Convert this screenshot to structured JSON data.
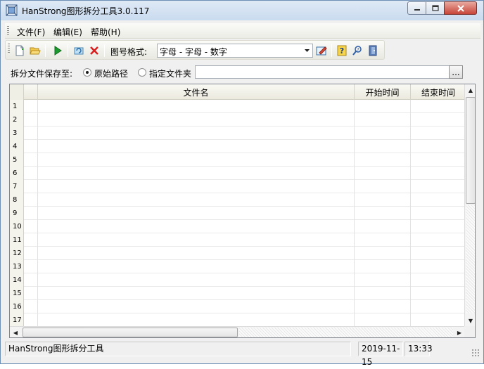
{
  "window": {
    "title": "HanStrong图形拆分工具3.0.117"
  },
  "menu": {
    "items": [
      "文件(F)",
      "编辑(E)",
      "帮助(H)"
    ]
  },
  "toolbar": {
    "buttons": [
      "new-file-icon",
      "open-folder-icon",
      "run-icon",
      "refresh-icon",
      "delete-icon",
      "edit-format-icon",
      "help-icon",
      "about-icon",
      "exit-icon"
    ],
    "format_label": "图号格式:",
    "format_value": "字母 - 字母 - 数字"
  },
  "save": {
    "label": "拆分文件保存至:",
    "option_original": "原始路径",
    "option_custom": "指定文件夹",
    "selected": "original",
    "path_value": "",
    "browse_label": "..."
  },
  "grid": {
    "columns": [
      "",
      "文件名",
      "开始时间",
      "结束时间"
    ],
    "row_numbers": [
      "1",
      "2",
      "3",
      "4",
      "5",
      "6",
      "7",
      "8",
      "9",
      "10",
      "11",
      "12",
      "13",
      "14",
      "15",
      "16",
      "17"
    ]
  },
  "status": {
    "app_name": "HanStrong图形拆分工具",
    "date": "2019-11-15",
    "time": "13:33"
  },
  "colors": {
    "title_bar": "#c9dbef",
    "close_button": "#c8463a",
    "accent_border": "#6d8fb5"
  }
}
